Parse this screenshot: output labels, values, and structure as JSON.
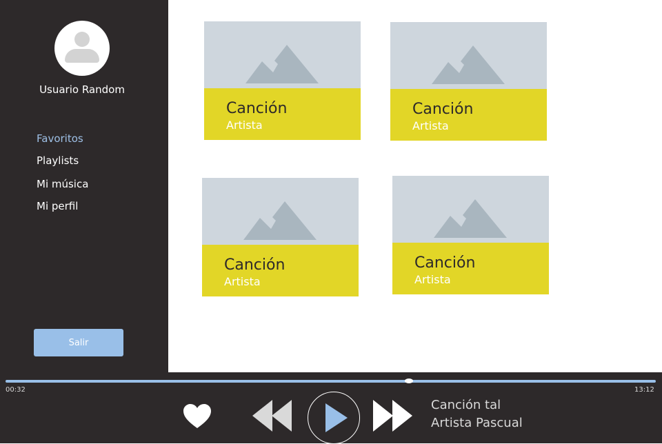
{
  "colors": {
    "sidebar_bg": "#2d292a",
    "accent_blue": "#99bfe8",
    "card_yellow": "#e2d627",
    "thumb_gray": "#ced6dd",
    "mountain_gray": "#a9b6bf"
  },
  "user": {
    "name": "Usuario Random",
    "avatar_icon": "user-icon"
  },
  "nav": {
    "items": [
      {
        "label": "Favoritos",
        "active": true
      },
      {
        "label": "Playlists"
      },
      {
        "label": "Mi música"
      },
      {
        "label": "Mi perfil"
      }
    ],
    "logout_label": "Salir"
  },
  "cards": [
    {
      "song": "Canción",
      "artist": "Artista",
      "image_icon": "image-placeholder-icon"
    },
    {
      "song": "Canción",
      "artist": "Artista",
      "image_icon": "image-placeholder-icon"
    },
    {
      "song": "Canción",
      "artist": "Artista",
      "image_icon": "image-placeholder-icon"
    },
    {
      "song": "Canción",
      "artist": "Artista",
      "image_icon": "image-placeholder-icon"
    }
  ],
  "player": {
    "elapsed": "00:32",
    "total": "13:12",
    "progress_fraction": 0.62,
    "now_playing_title": "Canción tal",
    "now_playing_artist": "Artista Pascual",
    "icons": [
      "heart-icon",
      "rewind-icon",
      "play-icon",
      "fast-forward-icon"
    ]
  }
}
